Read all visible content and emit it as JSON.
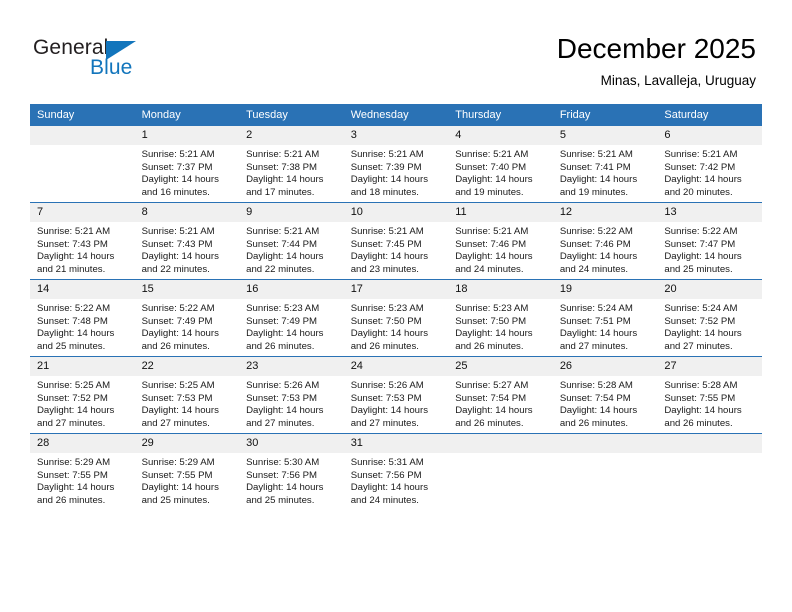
{
  "brand": {
    "name_part1": "General",
    "name_part2": "Blue",
    "color_primary": "#1275bc",
    "color_text": "#231f20",
    "logo_icon": "triangle-flag-icon"
  },
  "header": {
    "title": "December 2025",
    "subtitle": "Minas, Lavalleja, Uruguay"
  },
  "theme": {
    "header_row_bg": "#2a72b5",
    "daynum_bg": "#f0f0f0",
    "grid_line": "#2a72b5"
  },
  "calendar": {
    "weekday_headers": [
      "Sunday",
      "Monday",
      "Tuesday",
      "Wednesday",
      "Thursday",
      "Friday",
      "Saturday"
    ],
    "weeks": [
      [
        {
          "day": "",
          "details": ""
        },
        {
          "day": "1",
          "details": "Sunrise: 5:21 AM\nSunset: 7:37 PM\nDaylight: 14 hours\nand 16 minutes."
        },
        {
          "day": "2",
          "details": "Sunrise: 5:21 AM\nSunset: 7:38 PM\nDaylight: 14 hours\nand 17 minutes."
        },
        {
          "day": "3",
          "details": "Sunrise: 5:21 AM\nSunset: 7:39 PM\nDaylight: 14 hours\nand 18 minutes."
        },
        {
          "day": "4",
          "details": "Sunrise: 5:21 AM\nSunset: 7:40 PM\nDaylight: 14 hours\nand 19 minutes."
        },
        {
          "day": "5",
          "details": "Sunrise: 5:21 AM\nSunset: 7:41 PM\nDaylight: 14 hours\nand 19 minutes."
        },
        {
          "day": "6",
          "details": "Sunrise: 5:21 AM\nSunset: 7:42 PM\nDaylight: 14 hours\nand 20 minutes."
        }
      ],
      [
        {
          "day": "7",
          "details": "Sunrise: 5:21 AM\nSunset: 7:43 PM\nDaylight: 14 hours\nand 21 minutes."
        },
        {
          "day": "8",
          "details": "Sunrise: 5:21 AM\nSunset: 7:43 PM\nDaylight: 14 hours\nand 22 minutes."
        },
        {
          "day": "9",
          "details": "Sunrise: 5:21 AM\nSunset: 7:44 PM\nDaylight: 14 hours\nand 22 minutes."
        },
        {
          "day": "10",
          "details": "Sunrise: 5:21 AM\nSunset: 7:45 PM\nDaylight: 14 hours\nand 23 minutes."
        },
        {
          "day": "11",
          "details": "Sunrise: 5:21 AM\nSunset: 7:46 PM\nDaylight: 14 hours\nand 24 minutes."
        },
        {
          "day": "12",
          "details": "Sunrise: 5:22 AM\nSunset: 7:46 PM\nDaylight: 14 hours\nand 24 minutes."
        },
        {
          "day": "13",
          "details": "Sunrise: 5:22 AM\nSunset: 7:47 PM\nDaylight: 14 hours\nand 25 minutes."
        }
      ],
      [
        {
          "day": "14",
          "details": "Sunrise: 5:22 AM\nSunset: 7:48 PM\nDaylight: 14 hours\nand 25 minutes."
        },
        {
          "day": "15",
          "details": "Sunrise: 5:22 AM\nSunset: 7:49 PM\nDaylight: 14 hours\nand 26 minutes."
        },
        {
          "day": "16",
          "details": "Sunrise: 5:23 AM\nSunset: 7:49 PM\nDaylight: 14 hours\nand 26 minutes."
        },
        {
          "day": "17",
          "details": "Sunrise: 5:23 AM\nSunset: 7:50 PM\nDaylight: 14 hours\nand 26 minutes."
        },
        {
          "day": "18",
          "details": "Sunrise: 5:23 AM\nSunset: 7:50 PM\nDaylight: 14 hours\nand 26 minutes."
        },
        {
          "day": "19",
          "details": "Sunrise: 5:24 AM\nSunset: 7:51 PM\nDaylight: 14 hours\nand 27 minutes."
        },
        {
          "day": "20",
          "details": "Sunrise: 5:24 AM\nSunset: 7:52 PM\nDaylight: 14 hours\nand 27 minutes."
        }
      ],
      [
        {
          "day": "21",
          "details": "Sunrise: 5:25 AM\nSunset: 7:52 PM\nDaylight: 14 hours\nand 27 minutes."
        },
        {
          "day": "22",
          "details": "Sunrise: 5:25 AM\nSunset: 7:53 PM\nDaylight: 14 hours\nand 27 minutes."
        },
        {
          "day": "23",
          "details": "Sunrise: 5:26 AM\nSunset: 7:53 PM\nDaylight: 14 hours\nand 27 minutes."
        },
        {
          "day": "24",
          "details": "Sunrise: 5:26 AM\nSunset: 7:53 PM\nDaylight: 14 hours\nand 27 minutes."
        },
        {
          "day": "25",
          "details": "Sunrise: 5:27 AM\nSunset: 7:54 PM\nDaylight: 14 hours\nand 26 minutes."
        },
        {
          "day": "26",
          "details": "Sunrise: 5:28 AM\nSunset: 7:54 PM\nDaylight: 14 hours\nand 26 minutes."
        },
        {
          "day": "27",
          "details": "Sunrise: 5:28 AM\nSunset: 7:55 PM\nDaylight: 14 hours\nand 26 minutes."
        }
      ],
      [
        {
          "day": "28",
          "details": "Sunrise: 5:29 AM\nSunset: 7:55 PM\nDaylight: 14 hours\nand 26 minutes."
        },
        {
          "day": "29",
          "details": "Sunrise: 5:29 AM\nSunset: 7:55 PM\nDaylight: 14 hours\nand 25 minutes."
        },
        {
          "day": "30",
          "details": "Sunrise: 5:30 AM\nSunset: 7:56 PM\nDaylight: 14 hours\nand 25 minutes."
        },
        {
          "day": "31",
          "details": "Sunrise: 5:31 AM\nSunset: 7:56 PM\nDaylight: 14 hours\nand 24 minutes."
        },
        {
          "day": "",
          "details": ""
        },
        {
          "day": "",
          "details": ""
        },
        {
          "day": "",
          "details": ""
        }
      ]
    ]
  }
}
